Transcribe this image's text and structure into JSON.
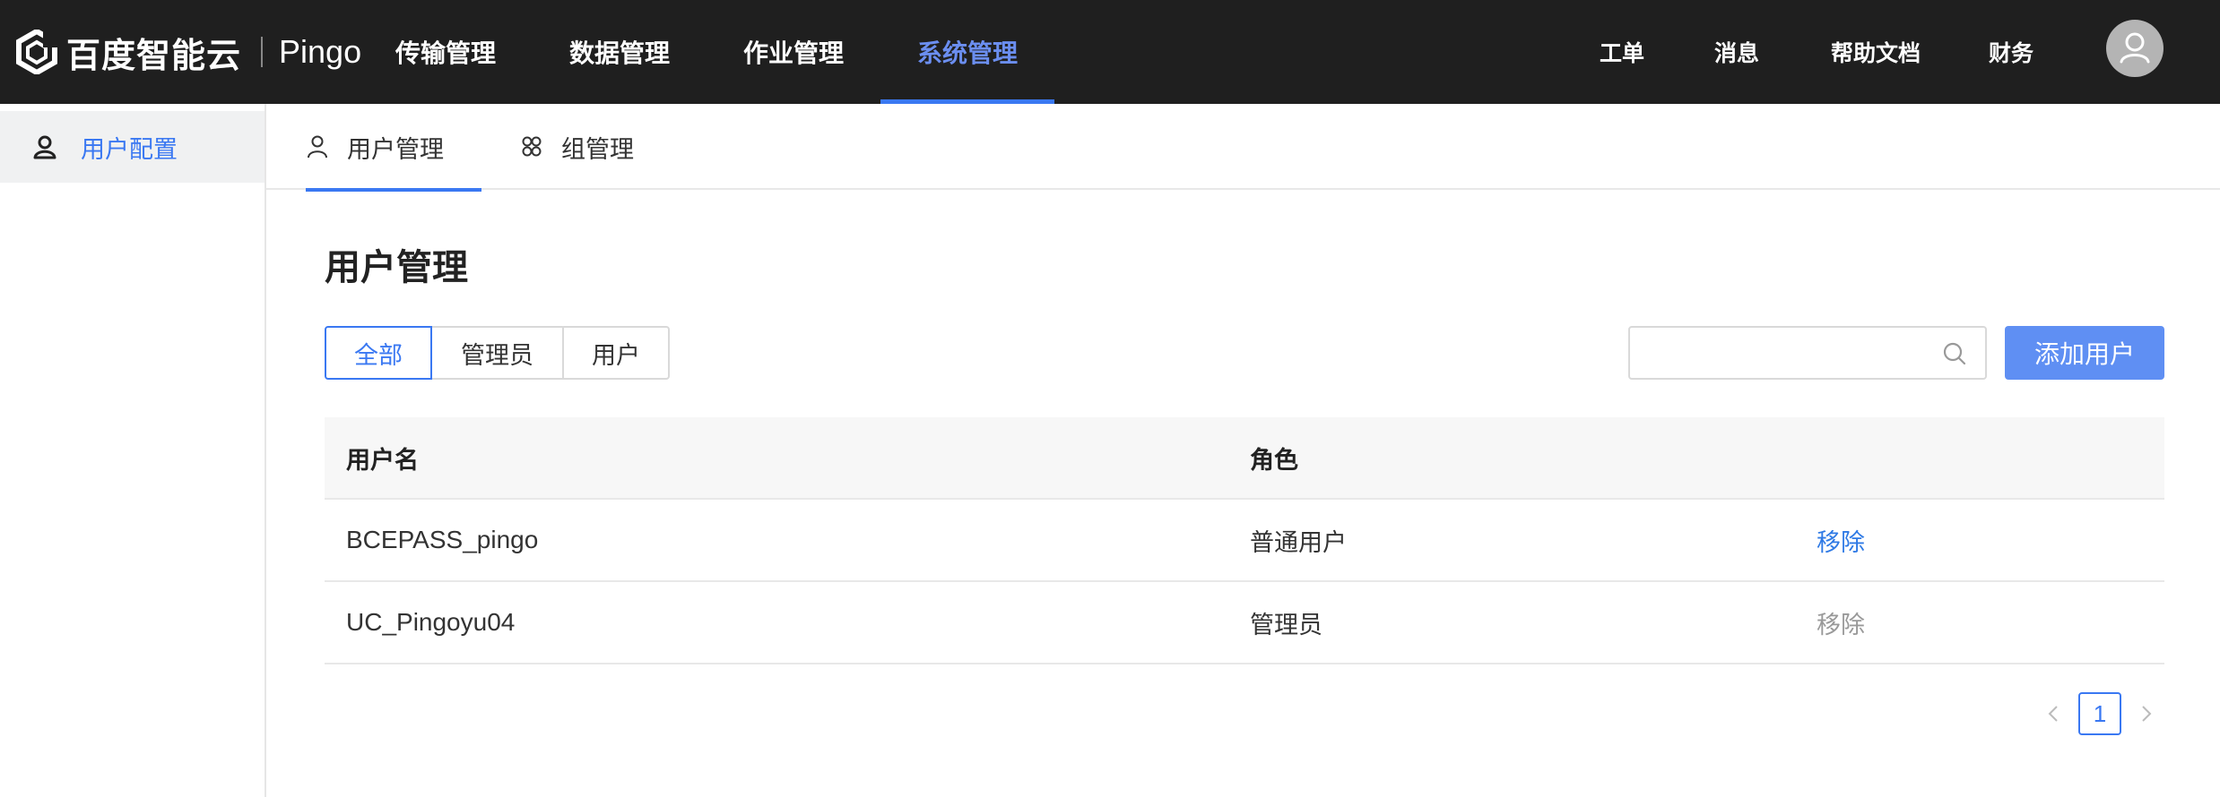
{
  "brand": {
    "name": "百度智能云",
    "product": "Pingo"
  },
  "nav": {
    "items": [
      {
        "label": "传输管理",
        "active": false
      },
      {
        "label": "数据管理",
        "active": false
      },
      {
        "label": "作业管理",
        "active": false
      },
      {
        "label": "系统管理",
        "active": true
      }
    ],
    "right": [
      "工单",
      "消息",
      "帮助文档",
      "财务"
    ]
  },
  "sidebar": {
    "items": [
      {
        "label": "用户配置",
        "icon": "user-icon",
        "active": true
      }
    ]
  },
  "tabs": [
    {
      "label": "用户管理",
      "icon": "user-icon",
      "active": true
    },
    {
      "label": "组管理",
      "icon": "group-icon",
      "active": false
    }
  ],
  "page": {
    "title": "用户管理"
  },
  "filters": [
    {
      "label": "全部",
      "active": true
    },
    {
      "label": "管理员",
      "active": false
    },
    {
      "label": "用户",
      "active": false
    }
  ],
  "search": {
    "placeholder": "",
    "value": ""
  },
  "add_button": "添加用户",
  "table": {
    "columns": [
      "用户名",
      "角色",
      ""
    ],
    "rows": [
      {
        "username": "BCEPASS_pingo",
        "role": "普通用户",
        "action": "移除",
        "action_enabled": true
      },
      {
        "username": "UC_Pingoyu04",
        "role": "管理员",
        "action": "移除",
        "action_enabled": false
      }
    ]
  },
  "pagination": {
    "current": "1"
  },
  "colors": {
    "accent": "#3a78f2",
    "topbar": "#1f1f1f",
    "button": "#5f8ff3",
    "link": "#2f7ae5"
  }
}
